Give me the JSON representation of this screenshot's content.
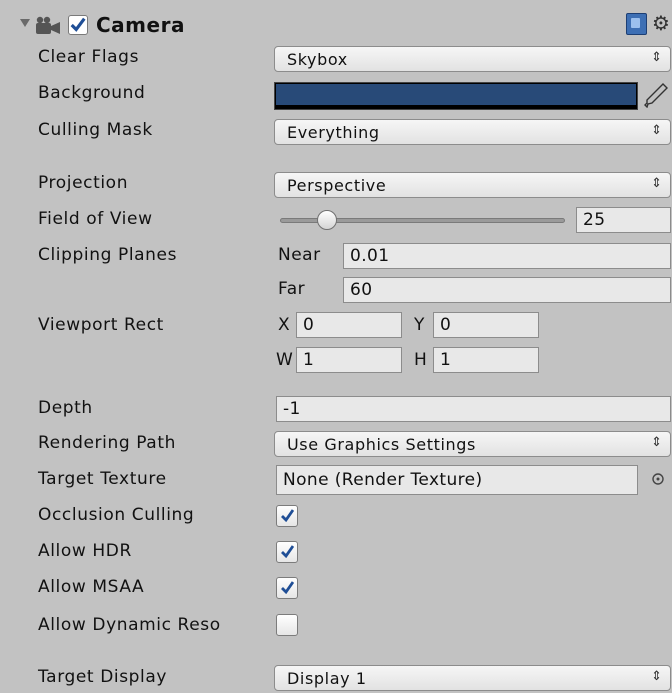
{
  "component": {
    "title": "Camera",
    "enabled": true
  },
  "icons": {
    "fold": "foldout-arrow-icon",
    "camera": "camera-icon",
    "help": "help-book-icon",
    "settings": "gear-icon"
  },
  "clear_flags": {
    "label": "Clear Flags",
    "value": "Skybox"
  },
  "background": {
    "label": "Background",
    "color": "#284a78"
  },
  "culling_mask": {
    "label": "Culling Mask",
    "value": "Everything"
  },
  "projection": {
    "label": "Projection",
    "value": "Perspective"
  },
  "fov": {
    "label": "Field of View",
    "value": "25",
    "slider_fraction": 0.14
  },
  "clipping": {
    "label": "Clipping Planes",
    "near_label": "Near",
    "near": "0.01",
    "far_label": "Far",
    "far": "60"
  },
  "viewport": {
    "label": "Viewport Rect",
    "x_label": "X",
    "x": "0",
    "y_label": "Y",
    "y": "0",
    "w_label": "W",
    "w": "1",
    "h_label": "H",
    "h": "1"
  },
  "depth": {
    "label": "Depth",
    "value": "-1"
  },
  "rendering_path": {
    "label": "Rendering Path",
    "value": "Use Graphics Settings"
  },
  "target_texture": {
    "label": "Target Texture",
    "value": "None (Render Texture)"
  },
  "occlusion": {
    "label": "Occlusion Culling",
    "checked": true
  },
  "hdr": {
    "label": "Allow HDR",
    "checked": true
  },
  "msaa": {
    "label": "Allow MSAA",
    "checked": true
  },
  "dynres": {
    "label": "Allow Dynamic Reso",
    "checked": false
  },
  "target_display": {
    "label": "Target Display",
    "value": "Display 1"
  }
}
